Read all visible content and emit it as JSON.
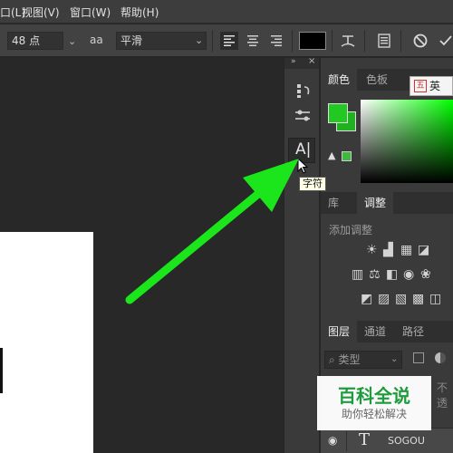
{
  "menubar": {
    "items": [
      {
        "label": "口(L)"
      },
      {
        "label": "视图(V)"
      },
      {
        "label": "窗口(W)"
      },
      {
        "label": "帮助(H)"
      }
    ]
  },
  "options": {
    "font_size": "48 点",
    "aa_icon": "aa",
    "antialias": "平滑",
    "text_color": "#000000"
  },
  "tool_strip": {
    "tooltip": "字符",
    "character_icon": "A|"
  },
  "color_panel": {
    "tabs": [
      "颜色",
      "色板"
    ],
    "foreground": "#22c922",
    "background": "#21b021",
    "gamut_swatch": "#3fb83f"
  },
  "adjust_panel": {
    "tabs": [
      "库",
      "调整"
    ],
    "heading": "添加调整"
  },
  "layers_panel": {
    "tabs": [
      "图层",
      "通道",
      "路径"
    ],
    "filter_label": "类型",
    "opacity_label": "不透",
    "layer_name": "SOGOU"
  },
  "ime": {
    "label": "英"
  },
  "watermark": {
    "title": "百科全说",
    "subtitle": "助你轻松解决"
  },
  "colors": {
    "arrow": "#1be61b"
  }
}
